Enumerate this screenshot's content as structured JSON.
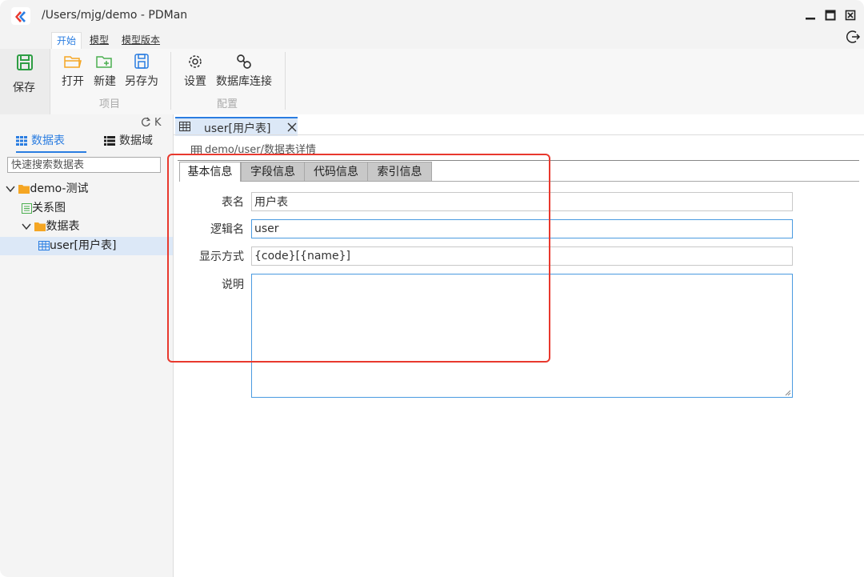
{
  "window": {
    "title": "/Users/mjg/demo - PDMan"
  },
  "menu": {
    "tabs": [
      {
        "label": "开始"
      },
      {
        "label": "模型"
      },
      {
        "label": "模型版本"
      }
    ]
  },
  "ribbon": {
    "save_label": "保存",
    "project_group": {
      "label": "项目",
      "buttons": [
        {
          "label": "打开"
        },
        {
          "label": "新建"
        },
        {
          "label": "另存为"
        }
      ]
    },
    "config_group": {
      "label": "配置",
      "buttons": [
        {
          "label": "设置"
        },
        {
          "label": "数据库连接"
        }
      ]
    }
  },
  "sidebar": {
    "tools": "K",
    "tabs": [
      {
        "label": "数据表"
      },
      {
        "label": "数据域"
      }
    ],
    "search_placeholder": "快速搜索数据表",
    "tree": [
      {
        "label": "demo-测试"
      },
      {
        "label": "关系图"
      },
      {
        "label": "数据表"
      },
      {
        "label": "user[用户表]"
      }
    ]
  },
  "main": {
    "doc_tab": "user[用户表]",
    "breadcrumb": "demo/user/数据表详情",
    "sub_tabs": [
      {
        "label": "基本信息"
      },
      {
        "label": "字段信息"
      },
      {
        "label": "代码信息"
      },
      {
        "label": "索引信息"
      }
    ],
    "form": {
      "table_name_label": "表名",
      "table_name_value": "用户表",
      "logic_name_label": "逻辑名",
      "logic_name_value": "user",
      "display_label": "显示方式",
      "display_value": "{code}[{name}]",
      "desc_label": "说明",
      "desc_value": ""
    }
  },
  "colors": {
    "accent": "#2a7de1",
    "highlight_box": "#e8392e",
    "folder": "#f5a623",
    "save_green": "#2e9e44"
  }
}
